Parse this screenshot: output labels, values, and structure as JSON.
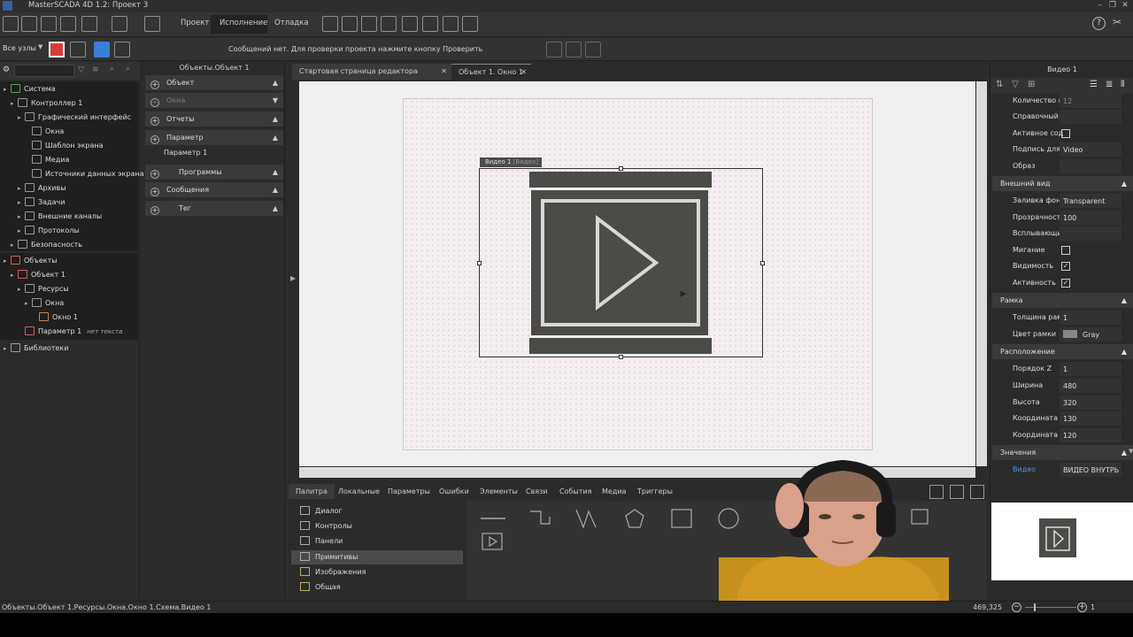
{
  "window": {
    "title": "MasterSCADA 4D 1.2: Проект 3"
  },
  "menu_tabs": [
    "Проект",
    "Исполнение",
    "Отладка"
  ],
  "toolbar2": {
    "nodes_select": "Все узлы",
    "message": "Сообщений нет. Для проверки проекта нажмите кнопку Проверить"
  },
  "tree": {
    "items": [
      {
        "label": "Система",
        "level": 0
      },
      {
        "label": "Контроллер 1",
        "level": 1
      },
      {
        "label": "Графический интерфейс",
        "level": 2
      },
      {
        "label": "Окна",
        "level": 3
      },
      {
        "label": "Шаблон экрана",
        "level": 3
      },
      {
        "label": "Медиа",
        "level": 3
      },
      {
        "label": "Источники данных экрана",
        "level": 3
      },
      {
        "label": "Архивы",
        "level": 2
      },
      {
        "label": "Задачи",
        "level": 2
      },
      {
        "label": "Внешние каналы",
        "level": 2
      },
      {
        "label": "Протоколы",
        "level": 2
      },
      {
        "label": "Безопасность",
        "level": 1
      },
      {
        "label": "Объекты",
        "level": 0
      },
      {
        "label": "Объект 1",
        "level": 1
      },
      {
        "label": "Ресурсы",
        "level": 2
      },
      {
        "label": "Окна",
        "level": 3
      },
      {
        "label": "Окно 1",
        "level": 4
      },
      {
        "label": "Параметр 1",
        "level": 2
      },
      {
        "label": "Библиотеки",
        "level": 0
      }
    ],
    "param_note": "нет текста"
  },
  "mid": {
    "title": "Объекты.Объект 1",
    "sections": [
      {
        "label": "Объект"
      },
      {
        "label": "Окна"
      },
      {
        "label": "Отчеты"
      },
      {
        "label": "Параметр"
      },
      {
        "label": "Программы"
      },
      {
        "label": "Сообщения"
      },
      {
        "label": "Тег"
      }
    ],
    "param_item": "Параметр 1"
  },
  "doc_tabs": [
    "Стартовая страница редактора проектов",
    "Объект 1. Окно 1"
  ],
  "canvas": {
    "element_label": "Видео 1",
    "element_type": "[Видео]"
  },
  "bottom_tabs": [
    "Палитра",
    "Локальные",
    "Параметры",
    "Ошибки",
    "Элементы",
    "Связи",
    "События",
    "Медиа",
    "Триггеры"
  ],
  "palette": [
    "Диалог",
    "Контролы",
    "Панели",
    "Примитивы",
    "Изображения",
    "Общая"
  ],
  "props": {
    "title": "Видео 1",
    "rows": [
      {
        "name": "Количество п",
        "value": "12"
      },
      {
        "name": "Справочный ;",
        "value": ""
      },
      {
        "name": "Активное сод",
        "value": ""
      },
      {
        "name": "Подпись для т",
        "value": "Video"
      },
      {
        "name": "Образ",
        "value": ""
      },
      {
        "name": "Заливка фона",
        "value": "Transparent"
      },
      {
        "name": "Прозрачность",
        "value": "100"
      },
      {
        "name": "Всплывающи",
        "value": ""
      },
      {
        "name": "Мигание",
        "value": ""
      },
      {
        "name": "Видимость",
        "value": "✓"
      },
      {
        "name": "Активность",
        "value": "✓"
      },
      {
        "name": "Толщина рам",
        "value": "1"
      },
      {
        "name": "Цвет рамки",
        "value": "Gray"
      },
      {
        "name": "Порядок Z",
        "value": "1"
      },
      {
        "name": "Ширина",
        "value": "480"
      },
      {
        "name": "Высота",
        "value": "320"
      },
      {
        "name": "Координата X",
        "value": "130"
      },
      {
        "name": "Координата Y",
        "value": "120"
      },
      {
        "name": "Видео",
        "value": "ВИДЕО ВНУТРЬ К"
      }
    ],
    "groups": [
      "Внешний вид",
      "Рамка",
      "Расположение",
      "Значения"
    ]
  },
  "status": {
    "path": "Объекты.Объект 1.Ресурсы.Окна.Окно 1.Схема.Видео 1",
    "coords": "469,325",
    "zoom": "1"
  },
  "colors": {
    "accent_red": "#d63b3b",
    "accent_blue": "#3a7fd6",
    "bg": "#2b2b2b"
  }
}
